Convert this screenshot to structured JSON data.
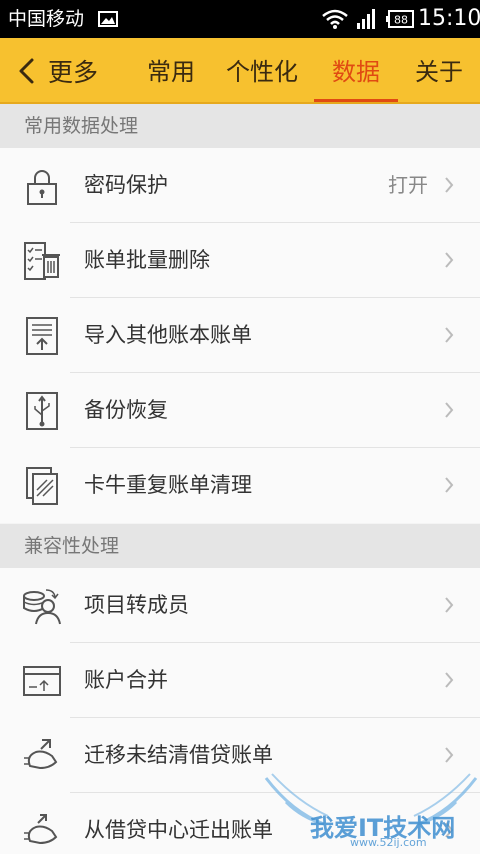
{
  "status_bar": {
    "carrier": "中国移动",
    "battery": "88",
    "time": "15:10"
  },
  "header": {
    "back_label": "更多",
    "tabs": [
      {
        "label": "常用",
        "active": false
      },
      {
        "label": "个性化",
        "active": false
      },
      {
        "label": "数据",
        "active": true
      },
      {
        "label": "关于",
        "active": false
      }
    ]
  },
  "sections": [
    {
      "title": "常用数据处理",
      "items": [
        {
          "label": "密码保护",
          "value": "打开",
          "icon": "lock-icon"
        },
        {
          "label": "账单批量删除",
          "icon": "batch-delete-icon"
        },
        {
          "label": "导入其他账本账单",
          "icon": "import-icon"
        },
        {
          "label": "备份恢复",
          "icon": "usb-backup-icon"
        },
        {
          "label": "卡牛重复账单清理",
          "icon": "duplicate-clean-icon"
        }
      ]
    },
    {
      "title": "兼容性处理",
      "items": [
        {
          "label": "项目转成员",
          "icon": "project-to-member-icon"
        },
        {
          "label": "账户合并",
          "icon": "account-merge-icon"
        },
        {
          "label": "迁移未结清借贷账单",
          "icon": "loan-migrate-icon"
        },
        {
          "label": "从借贷中心迁出账单",
          "icon": "loan-center-out-icon"
        }
      ]
    }
  ],
  "watermark": {
    "title": "我爱IT技术网",
    "subtitle": "www.52ij.com"
  }
}
